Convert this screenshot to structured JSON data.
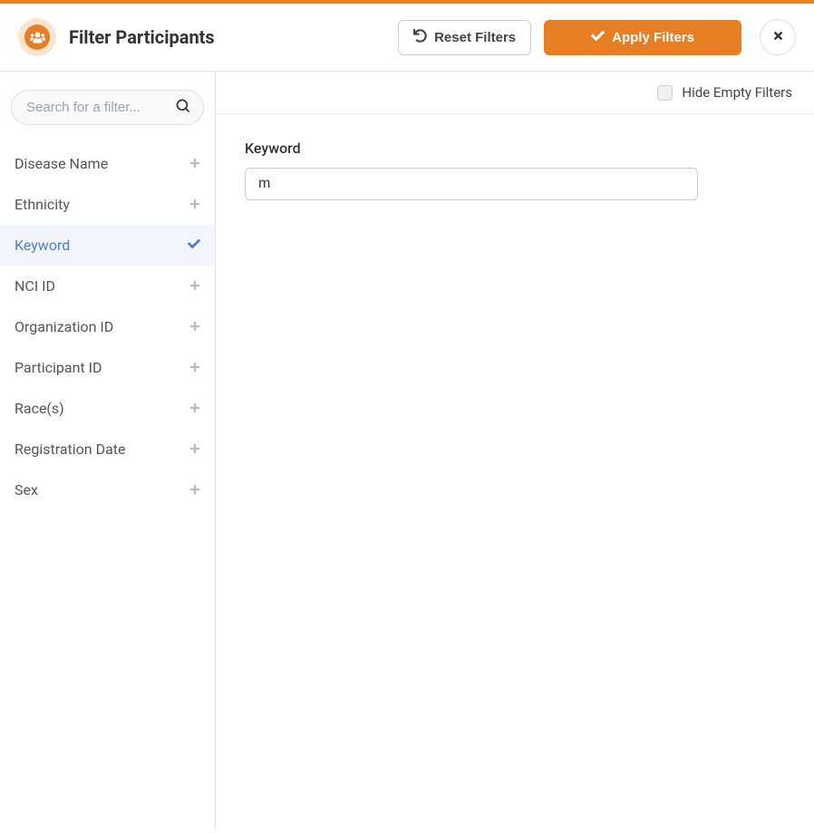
{
  "header": {
    "title": "Filter Participants",
    "reset_label": "Reset Filters",
    "apply_label": "Apply Filters"
  },
  "sidebar": {
    "search_placeholder": "Search for a filter...",
    "items": [
      {
        "label": "Disease Name",
        "active": false
      },
      {
        "label": "Ethnicity",
        "active": false
      },
      {
        "label": "Keyword",
        "active": true
      },
      {
        "label": "NCI ID",
        "active": false
      },
      {
        "label": "Organization ID",
        "active": false
      },
      {
        "label": "Participant ID",
        "active": false
      },
      {
        "label": "Race(s)",
        "active": false
      },
      {
        "label": "Registration Date",
        "active": false
      },
      {
        "label": "Sex",
        "active": false
      }
    ]
  },
  "main": {
    "hide_empty_label": "Hide Empty Filters",
    "field_label": "Keyword",
    "field_value": "m"
  }
}
